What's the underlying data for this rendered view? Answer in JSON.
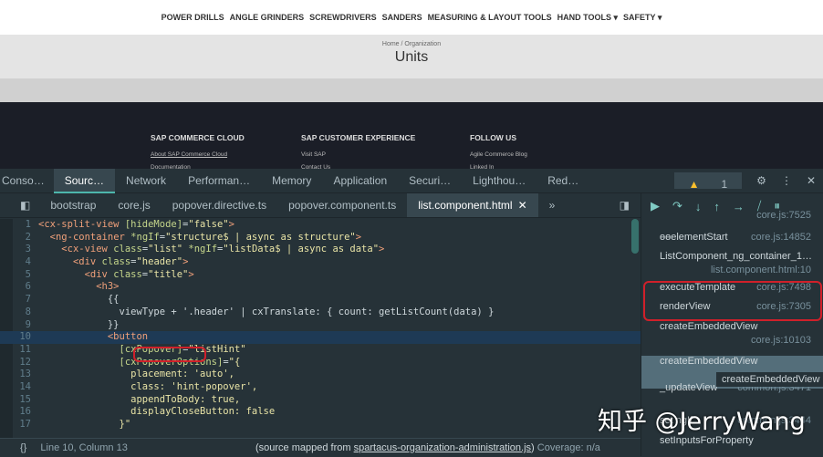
{
  "site": {
    "nav": [
      "POWER DRILLS",
      "ANGLE GRINDERS",
      "SCREWDRIVERS",
      "SANDERS",
      "MEASURING & LAYOUT TOOLS",
      "HAND TOOLS ▾",
      "SAFETY ▾"
    ],
    "breadcrumb": "Home / Organization",
    "title": "Units",
    "footer": [
      {
        "heading": "SAP COMMERCE CLOUD",
        "links": [
          "About SAP Commerce Cloud",
          "Documentation"
        ]
      },
      {
        "heading": "SAP CUSTOMER EXPERIENCE",
        "links": [
          "Visit SAP",
          "Contact Us"
        ]
      },
      {
        "heading": "FOLLOW US",
        "links": [
          "Agile Commerce Blog",
          "Linked In"
        ]
      }
    ]
  },
  "devtools": {
    "tabs": [
      "Conso…",
      "Sourc…",
      "Network",
      "Performan…",
      "Memory",
      "Application",
      "Securi…",
      "Lighthou…",
      "Red…"
    ],
    "active_tab": "Sourc…",
    "warnings": "1",
    "file_tabs": [
      "bootstrap",
      "core.js",
      "popover.directive.ts",
      "popover.component.ts",
      "list.component.html"
    ],
    "active_file": "list.component.html",
    "more": "»",
    "code": [
      {
        "n": "1",
        "seg": [
          [
            "t",
            "<cx-split-view "
          ],
          [
            "a",
            "[hideMode]"
          ],
          [
            "p",
            "="
          ],
          [
            "s",
            "\"false\""
          ],
          [
            "t",
            ">"
          ]
        ]
      },
      {
        "n": "2",
        "seg": [
          [
            "p",
            "  "
          ],
          [
            "t",
            "<ng-container "
          ],
          [
            "a",
            "*ngIf"
          ],
          [
            "p",
            "="
          ],
          [
            "s",
            "\"structure$ | async as structure\""
          ],
          [
            "t",
            ">"
          ]
        ]
      },
      {
        "n": "3",
        "seg": [
          [
            "p",
            "    "
          ],
          [
            "t",
            "<cx-view "
          ],
          [
            "a",
            "class"
          ],
          [
            "p",
            "="
          ],
          [
            "s",
            "\"list\" "
          ],
          [
            "a",
            "*ngIf"
          ],
          [
            "p",
            "="
          ],
          [
            "s",
            "\"listData$ | async as data\""
          ],
          [
            "t",
            ">"
          ]
        ]
      },
      {
        "n": "4",
        "seg": [
          [
            "p",
            "      "
          ],
          [
            "t",
            "<div "
          ],
          [
            "a",
            "class"
          ],
          [
            "p",
            "="
          ],
          [
            "s",
            "\"header\""
          ],
          [
            "t",
            ">"
          ]
        ]
      },
      {
        "n": "5",
        "seg": [
          [
            "p",
            "        "
          ],
          [
            "t",
            "<div "
          ],
          [
            "a",
            "class"
          ],
          [
            "p",
            "="
          ],
          [
            "s",
            "\"title\""
          ],
          [
            "t",
            ">"
          ]
        ]
      },
      {
        "n": "6",
        "seg": [
          [
            "p",
            "          "
          ],
          [
            "t",
            "<h3>"
          ]
        ]
      },
      {
        "n": "7",
        "seg": [
          [
            "p",
            "            {{"
          ]
        ]
      },
      {
        "n": "8",
        "seg": [
          [
            "p",
            "              viewType + '.header' | cxTranslate: { count: getListCount(data) }"
          ]
        ]
      },
      {
        "n": "9",
        "seg": [
          [
            "p",
            "            }}"
          ]
        ]
      },
      {
        "n": "10",
        "seg": [
          [
            "p",
            "            "
          ],
          [
            "t",
            "<button"
          ]
        ]
      },
      {
        "n": "11",
        "seg": [
          [
            "p",
            "              "
          ],
          [
            "a",
            "[cxPopover]"
          ],
          [
            "p",
            "="
          ],
          [
            "s",
            "\"listHint\""
          ]
        ]
      },
      {
        "n": "12",
        "seg": [
          [
            "p",
            "              "
          ],
          [
            "a",
            "[cxPopoverOptions]"
          ],
          [
            "p",
            "="
          ],
          [
            "s",
            "\"{"
          ]
        ]
      },
      {
        "n": "13",
        "seg": [
          [
            "s",
            "                placement: 'auto',"
          ]
        ]
      },
      {
        "n": "14",
        "seg": [
          [
            "s",
            "                class: 'hint-popover',"
          ]
        ]
      },
      {
        "n": "15",
        "seg": [
          [
            "s",
            "                appendToBody: true,"
          ]
        ]
      },
      {
        "n": "16",
        "seg": [
          [
            "s",
            "                displayCloseButton: false"
          ]
        ]
      },
      {
        "n": "17",
        "seg": [
          [
            "s",
            "              }\""
          ]
        ]
      }
    ],
    "status": {
      "position": "Line 10, Column 13",
      "source_prefix": "(source mapped from ",
      "source_link": "spartacus-organization-administration.js",
      "source_suffix": ")",
      "coverage": "Coverage: n/a"
    },
    "call_stack": [
      {
        "fn": "",
        "loc": "core.js:7525"
      },
      {
        "fn": "ɵɵelementStart",
        "loc": "core.js:14852"
      },
      {
        "fn": "ListComponent_ng_container_1…",
        "loc": "list.component.html:10"
      },
      {
        "fn": "executeTemplate",
        "loc": "core.js:7498"
      },
      {
        "fn": "renderView",
        "loc": "core.js:7305"
      },
      {
        "fn": "createEmbeddedView",
        "loc": "core.js:10103"
      },
      {
        "fn": "createEmbeddedView",
        "loc": ""
      },
      {
        "fn": "_updateView",
        "loc": "common.js:3471"
      },
      {
        "fn": "set ngIf",
        "loc": "common.js:3444"
      },
      {
        "fn": "setInputsForProperty",
        "loc": ""
      }
    ],
    "tooltip": "createEmbeddedView"
  },
  "watermark": "知乎 @JerryWang"
}
